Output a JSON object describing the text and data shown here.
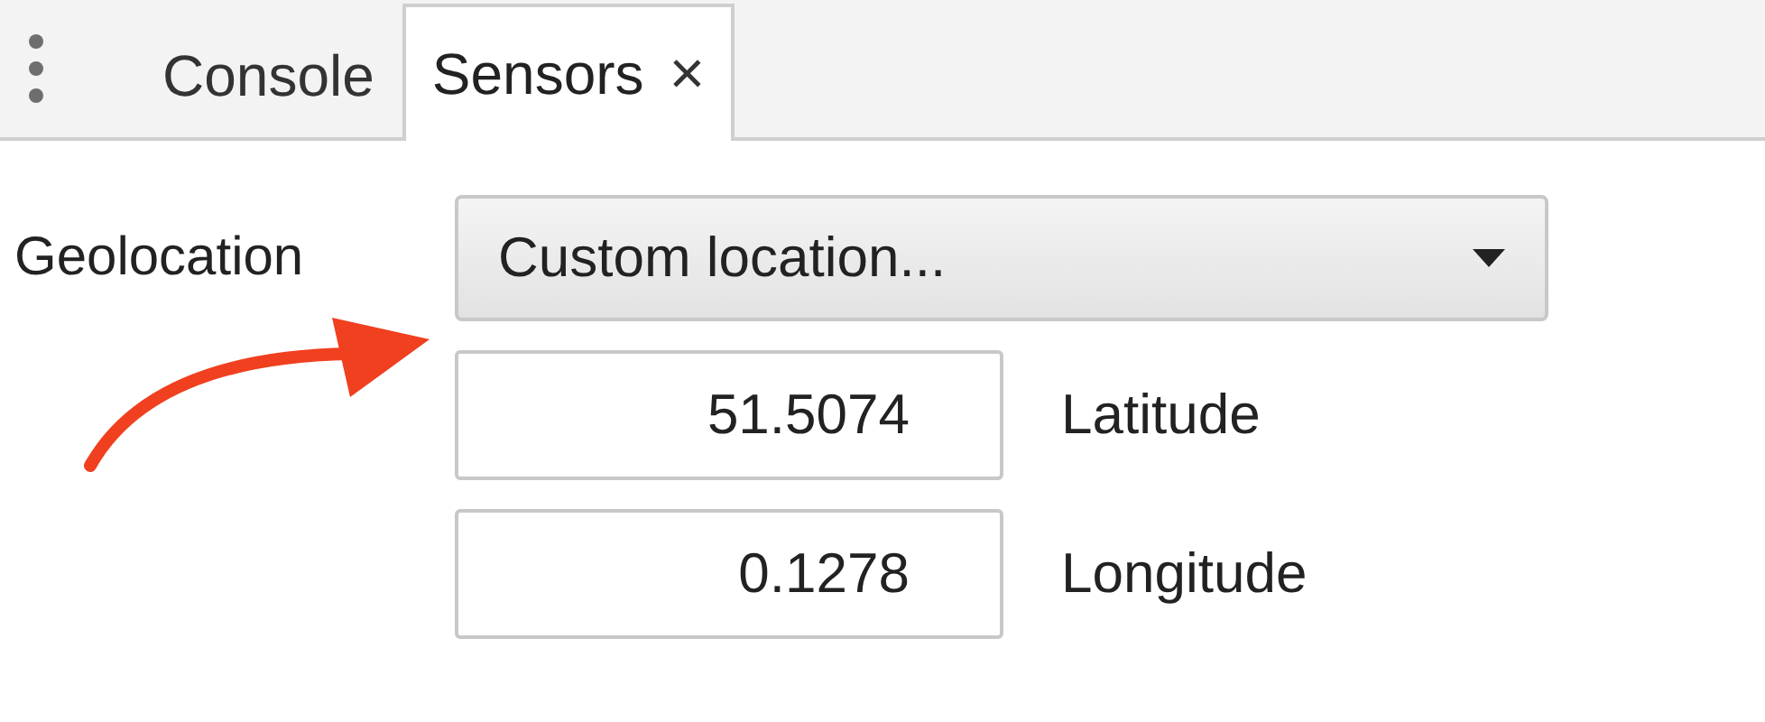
{
  "tabs": [
    {
      "label": "Console",
      "selected": false,
      "closable": false
    },
    {
      "label": "Sensors",
      "selected": true,
      "closable": true
    }
  ],
  "close_glyph": "×",
  "geolocation": {
    "label": "Geolocation",
    "dropdown": {
      "value": "Custom location..."
    },
    "fields": [
      {
        "value": "51.5074",
        "label": "Latitude"
      },
      {
        "value": "0.1278",
        "label": "Longitude"
      }
    ]
  }
}
